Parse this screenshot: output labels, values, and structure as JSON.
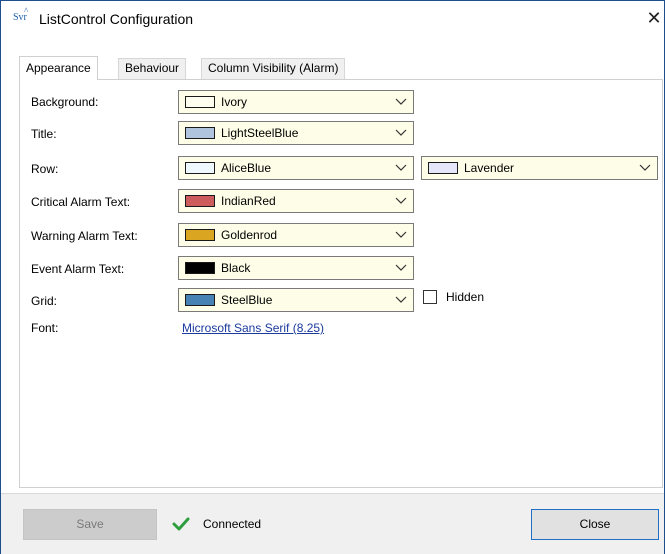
{
  "window": {
    "title": "ListControl Configuration",
    "icon_text": "Svr",
    "icon_caret": "^",
    "close_glyph": "✕"
  },
  "tabs": [
    {
      "label": "Appearance",
      "active": true
    },
    {
      "label": "Behaviour",
      "active": false
    },
    {
      "label": "Column Visibility (Alarm)",
      "active": false
    }
  ],
  "fields": {
    "background": {
      "label": "Background:",
      "color_name": "Ivory",
      "swatch": "#fffff0"
    },
    "title": {
      "label": "Title:",
      "color_name": "LightSteelBlue",
      "swatch": "#b0c4de"
    },
    "row": {
      "label": "Row:",
      "color_name": "AliceBlue",
      "swatch": "#f0f8ff",
      "alt_color_name": "Lavender",
      "alt_swatch": "#e6e6fa"
    },
    "critical": {
      "label": "Critical Alarm Text:",
      "color_name": "IndianRed",
      "swatch": "#cd5c5c"
    },
    "warning": {
      "label": "Warning Alarm Text:",
      "color_name": "Goldenrod",
      "swatch": "#daa520"
    },
    "event": {
      "label": "Event Alarm Text:",
      "color_name": "Black",
      "swatch": "#000000"
    },
    "grid": {
      "label": "Grid:",
      "color_name": "SteelBlue",
      "swatch": "#4682b4",
      "hidden_label": "Hidden",
      "hidden_checked": false
    },
    "font": {
      "label": "Font:",
      "value": "Microsoft Sans Serif (8.25)"
    }
  },
  "footer": {
    "save_label": "Save",
    "status_text": "Connected",
    "status_color": "#2e9e3e",
    "close_label": "Close"
  },
  "icons": {
    "combo_arrow": "chevron-down-icon",
    "status": "checkmark-icon",
    "close": "close-icon"
  }
}
